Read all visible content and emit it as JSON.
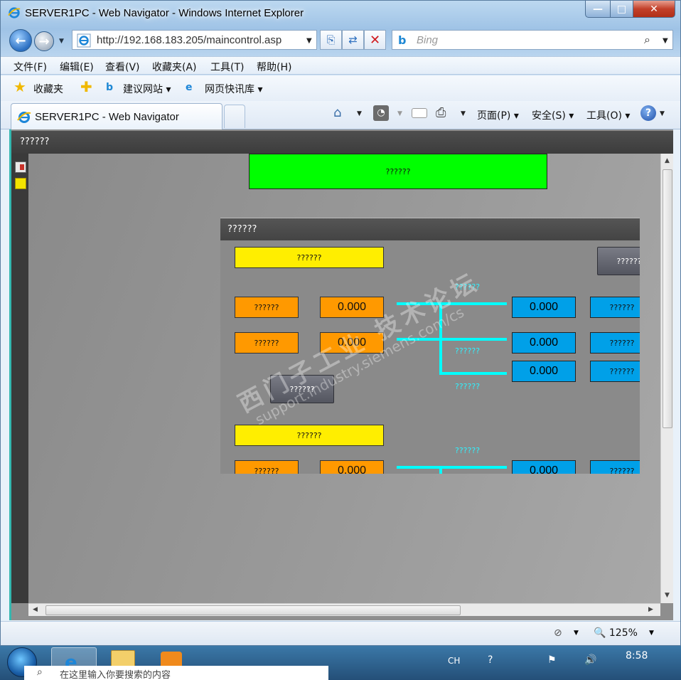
{
  "window": {
    "title": "SERVER1PC - Web Navigator - Windows Internet Explorer",
    "minimize": "—",
    "maximize": "□",
    "close": "✕"
  },
  "navigation": {
    "back_icon": "back-arrow-icon",
    "forward_icon": "forward-arrow-icon",
    "address": "http://192.168.183.205/maincontrol.asp",
    "search_placeholder": "Bing"
  },
  "menu": {
    "items": [
      "文件(F)",
      "编辑(E)",
      "查看(V)",
      "收藏夹(A)",
      "工具(T)",
      "帮助(H)"
    ]
  },
  "favorites": {
    "favorites_label": "收藏夹",
    "suggested_sites": "建议网站 ▾",
    "web_slice": "网页快讯库 ▾"
  },
  "tabs": {
    "active_label": "SERVER1PC - Web Navigator"
  },
  "commandbar": {
    "page": "页面(P)",
    "safety": "安全(S)",
    "tools": "工具(O)"
  },
  "app": {
    "header_title": "??????",
    "status_banner": "??????",
    "status_color": "#00ff00"
  },
  "popup": {
    "title": "??????",
    "section1_label": "??????",
    "section2_label": "??????",
    "gray_button_1": "??????",
    "gray_button_2": "??????",
    "orange_labels": [
      "??????",
      "??????",
      "??????"
    ],
    "orange_values": [
      "0.000",
      "0.000",
      "0.000"
    ],
    "blue_values": [
      "0.000",
      "0.000",
      "0.000",
      "0.000"
    ],
    "blue_labels": [
      "??????",
      "??????",
      "??????",
      "??????"
    ],
    "cyan_labels": [
      "??????",
      "??????",
      "??????",
      "??????"
    ]
  },
  "watermark": {
    "line1": "西门子工业 技术论坛",
    "line2": "support.industry.siemens.com/cs"
  },
  "statusbar": {
    "zoom": "125%"
  },
  "taskbar": {
    "language": "CH",
    "clock": "8:58",
    "search_text": "在这里输入你要搜索的内容"
  }
}
